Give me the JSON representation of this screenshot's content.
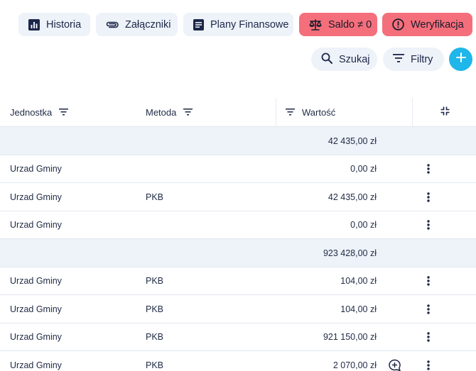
{
  "toolbar": {
    "historia": "Historia",
    "zalaczniki": "Załączniki",
    "plany": "Plany Finansowe",
    "saldo": "Saldo ≠ 0",
    "weryfikacja": "Weryfikacja"
  },
  "actions": {
    "szukaj": "Szukaj",
    "filtry": "Filtry"
  },
  "table": {
    "headers": {
      "jednostka": "Jednostka",
      "metoda": "Metoda",
      "wartosc": "Wartość"
    },
    "rows": [
      {
        "type": "group",
        "jednostka": "",
        "metoda": "",
        "wartosc": "42 435,00 zł"
      },
      {
        "type": "row",
        "jednostka": "Urzad Gminy",
        "metoda": "",
        "wartosc": "0,00 zł"
      },
      {
        "type": "row",
        "jednostka": "Urzad Gminy",
        "metoda": "PKB",
        "wartosc": "42 435,00 zł"
      },
      {
        "type": "row",
        "jednostka": "Urzad Gminy",
        "metoda": "",
        "wartosc": "0,00 zł"
      },
      {
        "type": "group",
        "jednostka": "",
        "metoda": "",
        "wartosc": "923 428,00 zł"
      },
      {
        "type": "row",
        "jednostka": "Urzad Gminy",
        "metoda": "PKB",
        "wartosc": "104,00 zł"
      },
      {
        "type": "row",
        "jednostka": "Urzad Gminy",
        "metoda": "PKB",
        "wartosc": "104,00 zł"
      },
      {
        "type": "row",
        "jednostka": "Urzad Gminy",
        "metoda": "PKB",
        "wartosc": "921 150,00 zł"
      },
      {
        "type": "row",
        "jednostka": "Urzad Gminy",
        "metoda": "PKB",
        "wartosc": "2 070,00 zł",
        "comment": true
      }
    ]
  },
  "colors": {
    "accent": "#1fb6e9",
    "danger": "#f46f7b",
    "button_bg": "#eef2f9",
    "text": "#1f2a44"
  },
  "icons": {
    "historia": "bar-chart-icon",
    "zalaczniki": "paperclip-icon",
    "plany": "document-icon",
    "saldo": "scale-icon",
    "weryfikacja": "alert-circle-icon",
    "szukaj": "search-icon",
    "filtry": "filter-icon",
    "add": "plus-icon",
    "collapse": "collapse-icon",
    "row_menu": "more-vertical-icon",
    "comment": "add-comment-icon"
  }
}
